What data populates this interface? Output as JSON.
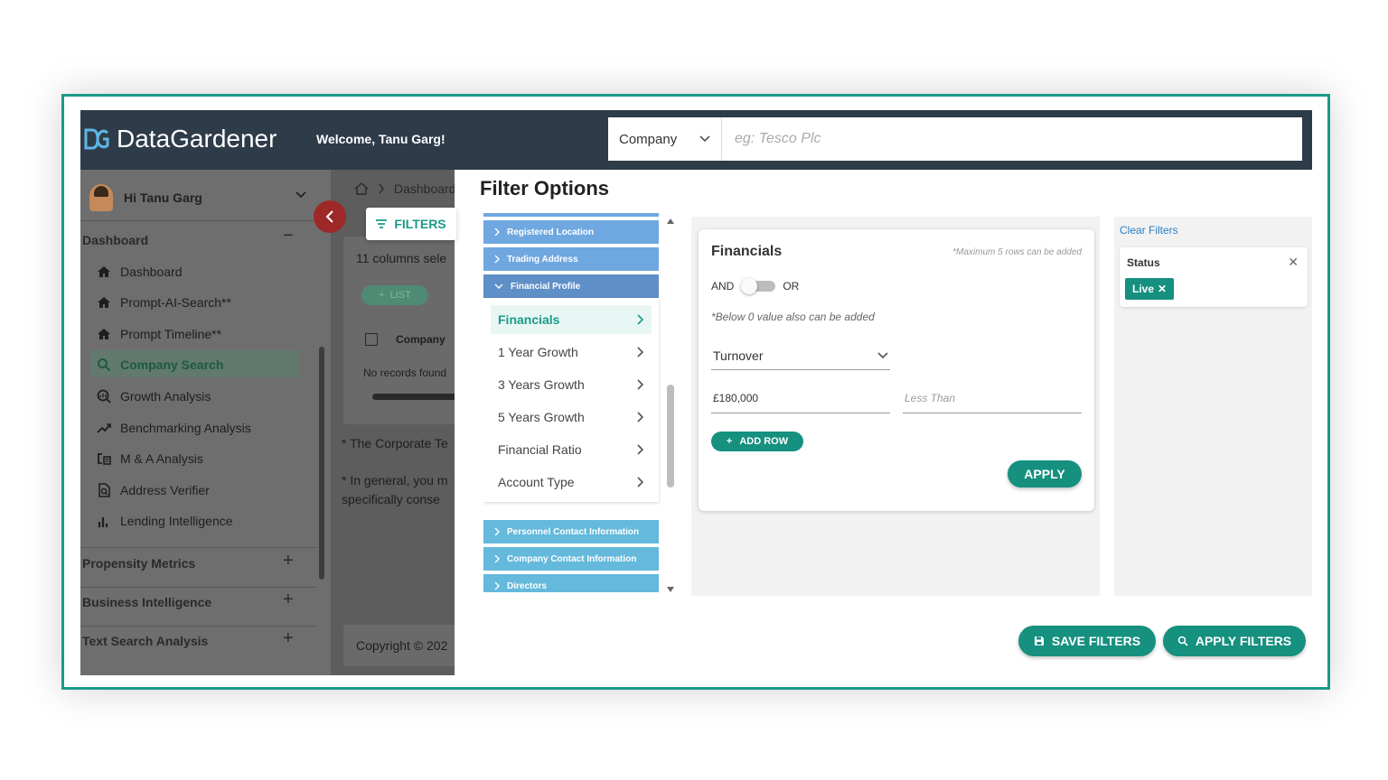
{
  "header": {
    "brand": "DataGardener",
    "welcome": "Welcome, Tanu Garg!",
    "search_type": "Company",
    "search_placeholder": "eg: Tesco Plc"
  },
  "sidebar": {
    "user": "Hi Tanu Garg",
    "section_dashboard": "Dashboard",
    "items": [
      {
        "label": "Dashboard",
        "icon": "home-icon"
      },
      {
        "label": "Prompt-AI-Search**",
        "icon": "home-icon"
      },
      {
        "label": "Prompt Timeline**",
        "icon": "home-icon"
      },
      {
        "label": "Company Search",
        "icon": "search-icon"
      },
      {
        "label": "Growth Analysis",
        "icon": "chart-search-icon"
      },
      {
        "label": "Benchmarking Analysis",
        "icon": "trend-icon"
      },
      {
        "label": "M & A Analysis",
        "icon": "merge-icon"
      },
      {
        "label": "Address Verifier",
        "icon": "document-search-icon"
      },
      {
        "label": "Lending Intelligence",
        "icon": "bar-chart-icon"
      }
    ],
    "sections": [
      "Propensity Metrics",
      "Business Intelligence",
      "Text Search Analysis"
    ]
  },
  "background": {
    "breadcrumb": "Dashboard",
    "columns_text": "11 columns sele",
    "list_btn": "LIST",
    "table_header": "Company",
    "no_records": "No records found",
    "note1": "The Corporate Te",
    "note2a": "In general, you m",
    "note2b": "specifically conse",
    "copyright": "Copyright © 202",
    "filters_chip": "FILTERS"
  },
  "filter_panel": {
    "title": "Filter Options",
    "categories_top": [
      "Registered Location",
      "Trading Address",
      "Financial Profile"
    ],
    "subcategories": [
      "Financials",
      "1 Year Growth",
      "3 Years Growth",
      "5 Years Growth",
      "Financial Ratio",
      "Account Type"
    ],
    "categories_bottom": [
      "Personnel Contact Information",
      "Company Contact Information",
      "Directors"
    ],
    "criteria": {
      "title": "Financials",
      "note": "*Maximum 5 rows can be added",
      "and_label": "AND",
      "or_label": "OR",
      "below_note": "*Below 0 value also can be added",
      "metric": "Turnover",
      "value": "£180,000",
      "condition_placeholder": "Less Than",
      "add_row": "ADD ROW",
      "apply": "APPLY"
    },
    "selected": {
      "clear": "Clear Filters",
      "status_title": "Status",
      "status_chip": "Live"
    },
    "save_filters": "SAVE FILTERS",
    "apply_filters": "APPLY FILTERS"
  },
  "colors": {
    "teal": "#16907f",
    "header": "#2e3b48",
    "category_blue": "#6fa7e0",
    "category_light": "#64b9dc"
  }
}
